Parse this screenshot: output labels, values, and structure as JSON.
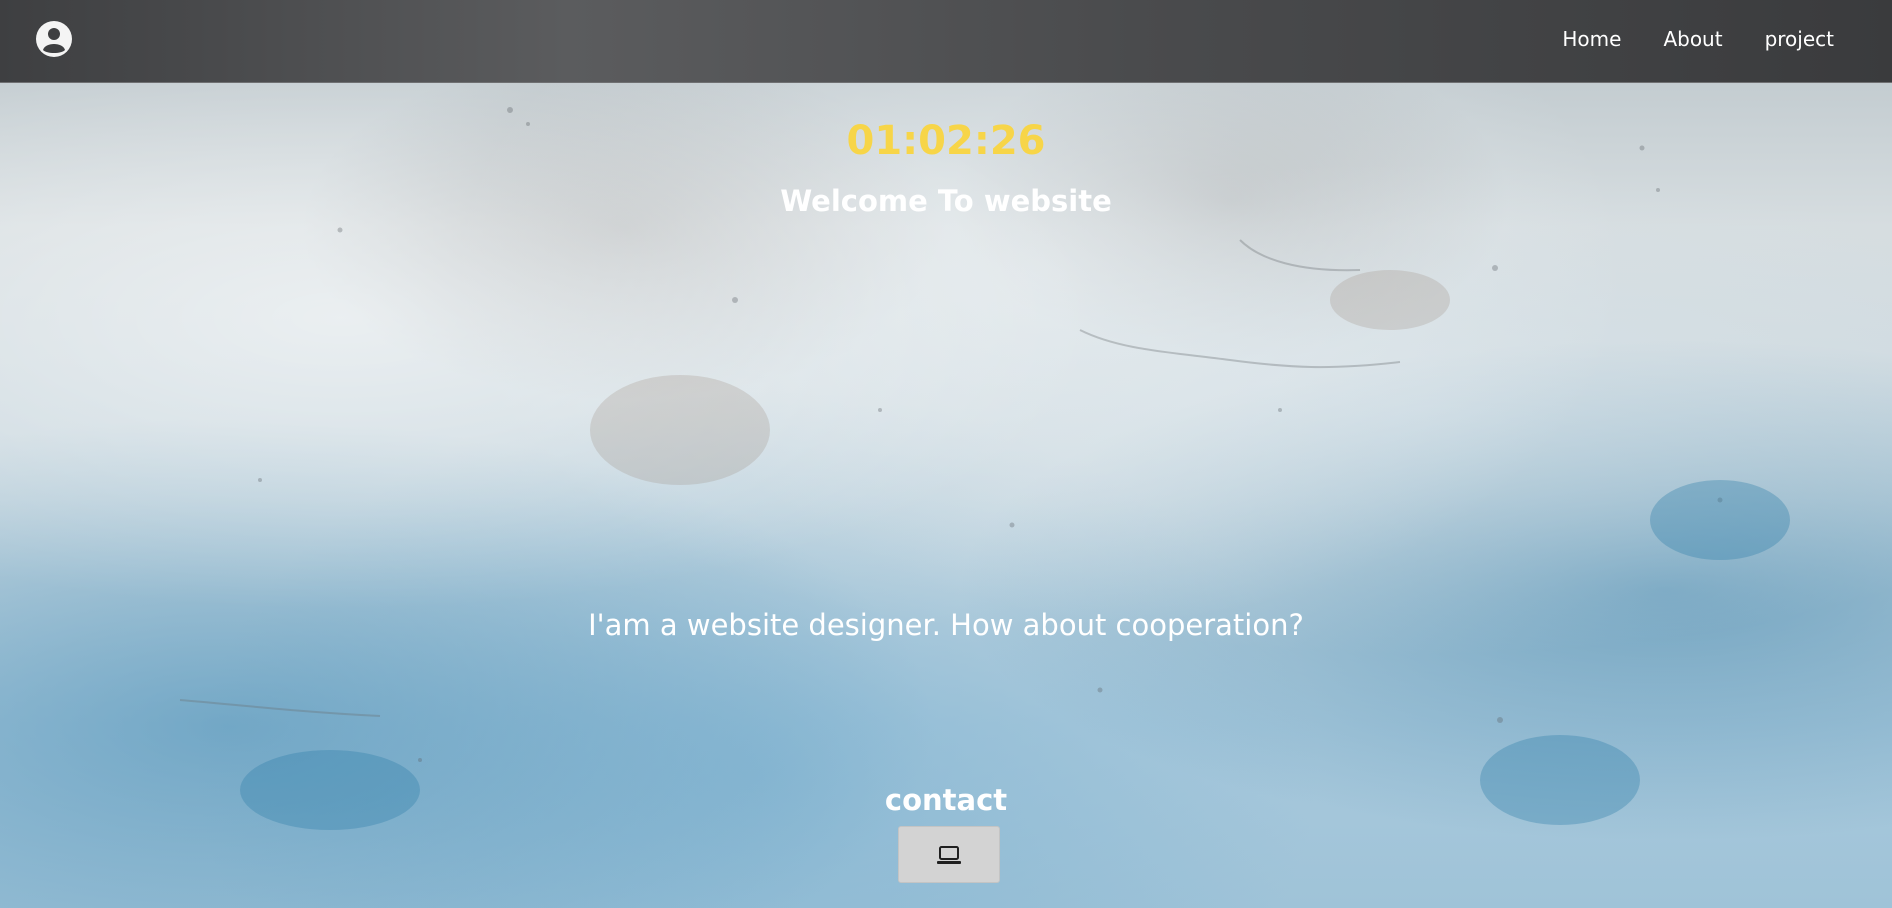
{
  "header": {
    "avatar_icon": "user-circle-icon",
    "nav": [
      {
        "label": "Home"
      },
      {
        "label": "About"
      },
      {
        "label": "project"
      }
    ]
  },
  "hero": {
    "clock": "01:02:26",
    "welcome": "Welcome To website",
    "tagline": "I'am a website designer. How about cooperation?"
  },
  "contact": {
    "label": "contact",
    "button_icon": "laptop-icon"
  },
  "colors": {
    "clock": "#f7d548",
    "navbar": "#4a4b4d",
    "text": "#ffffff",
    "button": "#d3d3d3"
  }
}
